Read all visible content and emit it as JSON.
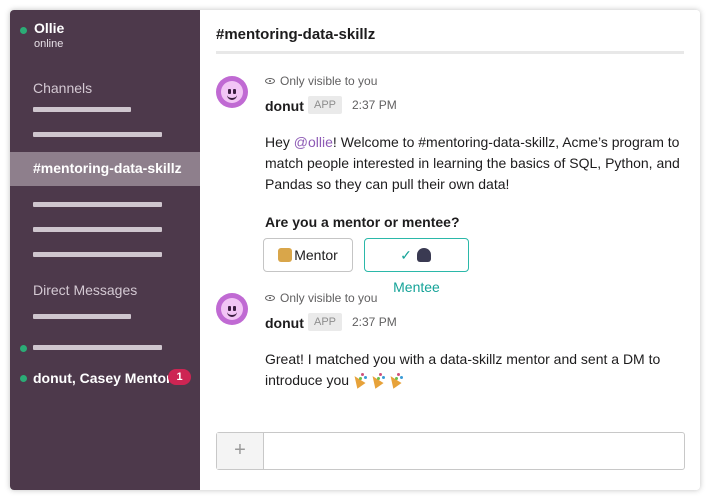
{
  "sidebar": {
    "user_name": "Ollie",
    "user_status": "online",
    "channels_title": "Channels",
    "active_channel": "#mentoring-data-skillz",
    "dm_title": "Direct Messages",
    "dm_item": "donut, Casey Mentor",
    "dm_badge": "1"
  },
  "channel": {
    "title": "#mentoring-data-skillz"
  },
  "messages": [
    {
      "visibility": "Only visible to you",
      "sender": "donut",
      "app_badge": "APP",
      "time": "2:37 PM",
      "text_before": "Hey ",
      "mention": "@ollie",
      "text_after": "! Welcome to #mentoring-data-skillz, Acme’s program to match people interested in learning the basics of SQL, Python, and Pandas so they can pull their own data!",
      "question": "Are you a mentor or mentee?",
      "buttons": {
        "mentor": "Mentor",
        "mentee": "Mentee",
        "mentee_check": "✓"
      }
    },
    {
      "visibility": "Only visible to you",
      "sender": "donut",
      "app_badge": "APP",
      "time": "2:37 PM",
      "text": "Great! I matched you with a data-skillz mentor and sent a DM to introduce you"
    }
  ],
  "composer": {
    "add_label": "+",
    "placeholder": ""
  },
  "colors": {
    "sidebar_bg": "#4d394b",
    "active_channel_bg": "#8e7f8c",
    "presence": "#2bac76",
    "badge": "#cd2553",
    "mentee_accent": "#15a398",
    "mention": "#8d5ab5"
  },
  "icons": [
    "presence-dot",
    "eye-icon",
    "donut-avatar",
    "mentor-emoji",
    "mentee-emoji",
    "party-popper-emoji",
    "plus-icon"
  ]
}
